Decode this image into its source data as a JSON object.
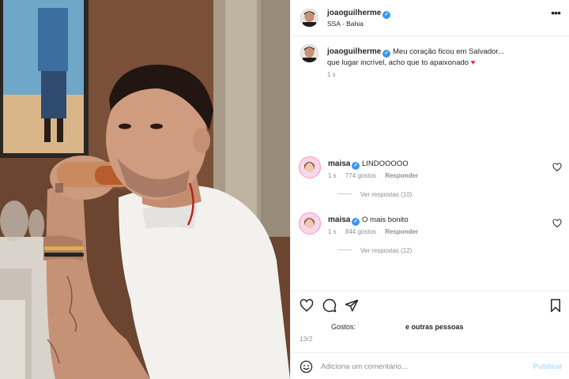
{
  "post": {
    "username": "joaoguilherme",
    "location": "SSA - Bahia",
    "caption_line1": "Meu coração ficou em Salvador...",
    "caption_line2": "que lugar incrível, acho que to apaixonado",
    "caption_time": "1 s"
  },
  "comments": [
    {
      "username": "maisa",
      "text": "LINDOOOOO",
      "time": "1 s",
      "likes": "774 gostos",
      "reply_label": "Responder",
      "view_replies": "Ver respostas (10)"
    },
    {
      "username": "maisa",
      "text": "O mais bonito",
      "time": "1 s",
      "likes": "844 gostos",
      "reply_label": "Responder",
      "view_replies": "Ver respostas (12)"
    }
  ],
  "likes_line": {
    "prefix": "Gostos: ",
    "suffix": "e outras pessoas"
  },
  "date": "13/2",
  "add_comment": {
    "placeholder": "Adiciona um comentário...",
    "publish_label": "Publicar"
  },
  "icons": {
    "verified": "verified-badge-icon",
    "more": "more-options-icon",
    "like": "heart-icon",
    "comment": "comment-bubble-icon",
    "share": "paper-plane-icon",
    "save": "bookmark-icon",
    "emoji": "smiley-icon"
  },
  "colors": {
    "verified_blue": "#3897f0",
    "publish_disabled": "#b2dffc",
    "muted_text": "#8e8e8e"
  }
}
